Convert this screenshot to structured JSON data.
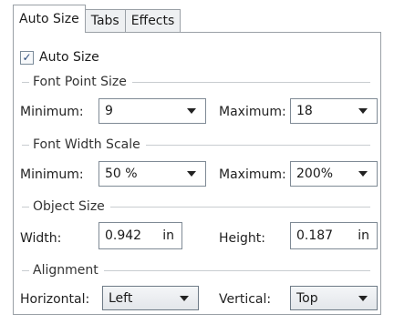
{
  "tabs": [
    {
      "label": "Auto Size",
      "active": true
    },
    {
      "label": "Tabs",
      "active": false
    },
    {
      "label": "Effects",
      "active": false
    }
  ],
  "auto_size": {
    "label": "Auto Size",
    "checked": true
  },
  "font_point_size": {
    "title": "Font Point Size",
    "minimum_label": "Minimum:",
    "minimum_value": "9",
    "maximum_label": "Maximum:",
    "maximum_value": "18"
  },
  "font_width_scale": {
    "title": "Font Width Scale",
    "minimum_label": "Minimum:",
    "minimum_value": "50 %",
    "maximum_label": "Maximum:",
    "maximum_value": "200%"
  },
  "object_size": {
    "title": "Object Size",
    "width_label": "Width:",
    "width_value": "0.942",
    "width_unit": "in",
    "height_label": "Height:",
    "height_value": "0.187",
    "height_unit": "in"
  },
  "alignment": {
    "title": "Alignment",
    "horizontal_label": "Horizontal:",
    "horizontal_value": "Left",
    "vertical_label": "Vertical:",
    "vertical_value": "Top"
  },
  "icons": {
    "checkmark": "checkmark-icon",
    "dropdown": "chevron-down-icon"
  }
}
